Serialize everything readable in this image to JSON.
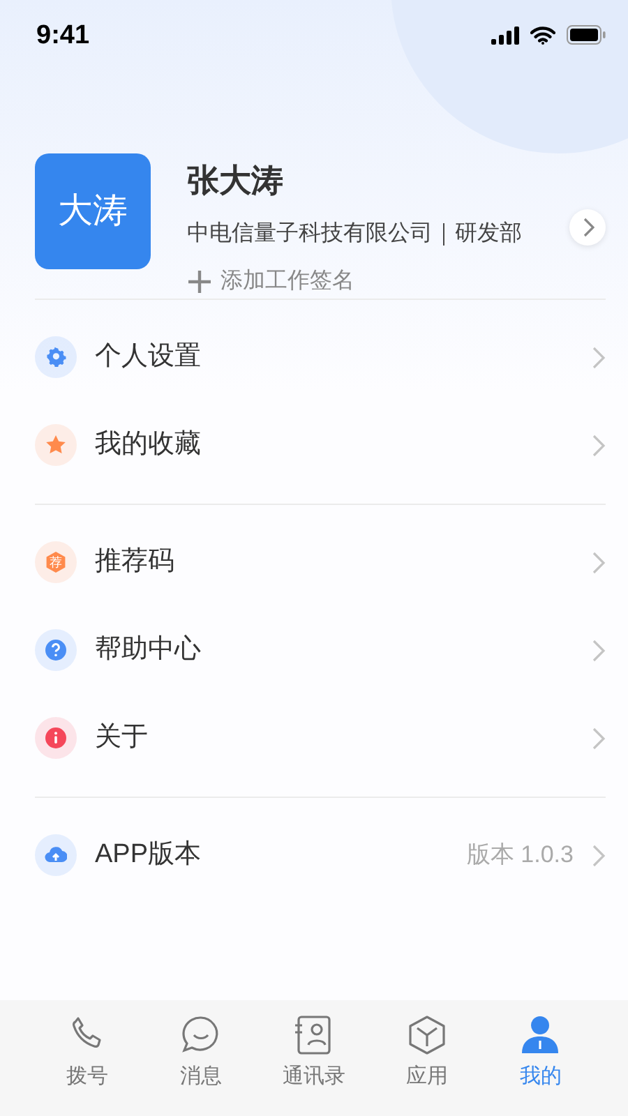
{
  "status_bar": {
    "time": "9:41"
  },
  "profile": {
    "avatar_text": "大涛",
    "name": "张大涛",
    "org": "中电信量子科技有限公司｜研发部",
    "add_signature": "添加工作签名"
  },
  "menu_groups": [
    [
      {
        "kind": "gear",
        "label": "个人设置",
        "color": "#4a8ef5"
      },
      {
        "kind": "star",
        "label": "我的收藏",
        "color": "#ff8a4c"
      }
    ],
    [
      {
        "kind": "hexagon",
        "label": "推荐码",
        "color": "#ff8a4c",
        "icon_text": "荐"
      },
      {
        "kind": "help",
        "label": "帮助中心",
        "color": "#4a8ef5"
      },
      {
        "kind": "info",
        "label": "关于",
        "color": "#f5475a"
      }
    ],
    [
      {
        "kind": "cloud",
        "label": "APP版本",
        "color": "#4a8ef5",
        "value": "版本 1.0.3"
      }
    ]
  ],
  "tabs": [
    {
      "kind": "phone",
      "label": "拨号",
      "selected": false
    },
    {
      "kind": "chat",
      "label": "消息",
      "selected": false
    },
    {
      "kind": "contacts",
      "label": "通讯录",
      "selected": false
    },
    {
      "kind": "cube",
      "label": "应用",
      "selected": false
    },
    {
      "kind": "person",
      "label": "我的",
      "selected": true
    }
  ]
}
